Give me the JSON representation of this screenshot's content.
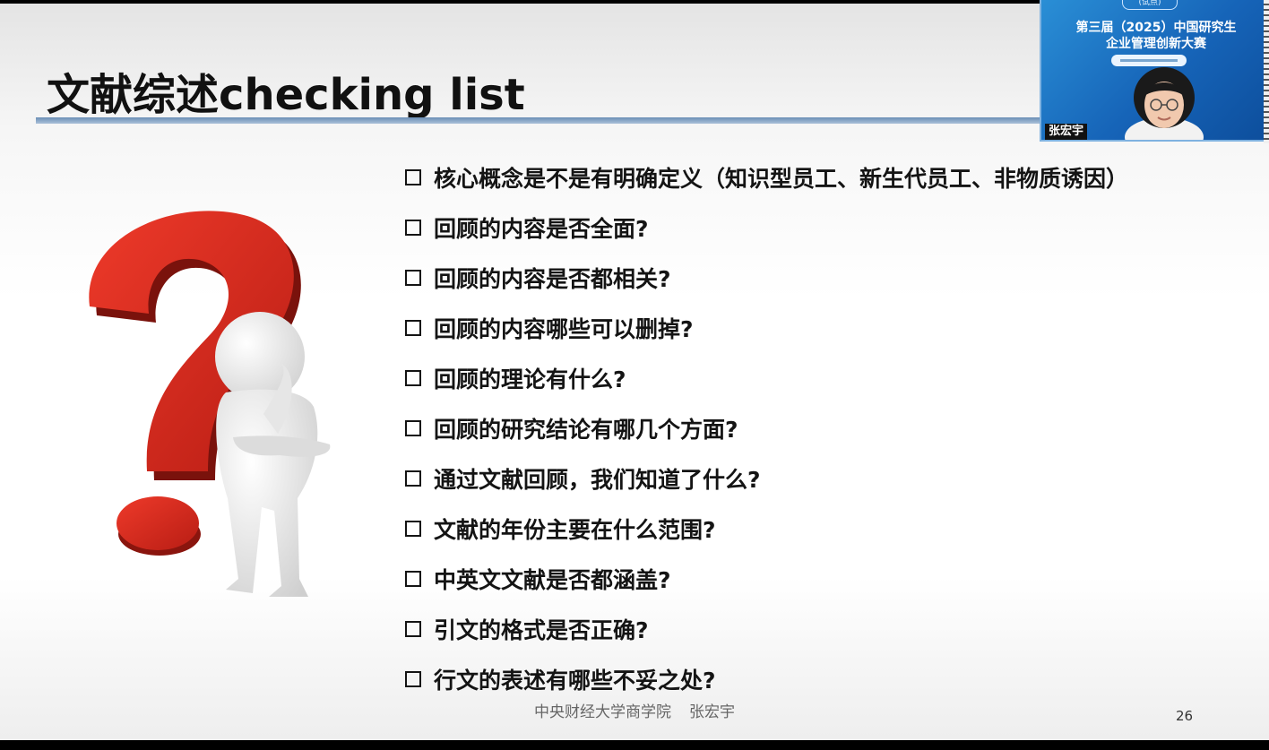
{
  "slide": {
    "title": "文献综述checking list",
    "items": [
      "核心概念是不是有明确定义（知识型员工、新生代员工、非物质诱因）",
      "回顾的内容是否全面?",
      "回顾的内容是否都相关?",
      "回顾的内容哪些可以删掉?",
      "回顾的理论有什么?",
      "回顾的研究结论有哪几个方面?",
      "通过文献回顾，我们知道了什么?",
      "文献的年份主要在什么范围?",
      "中英文文献是否都涵盖?",
      "引文的格式是否正确?",
      "行文的表述有哪些不妥之处?"
    ],
    "footer": {
      "school": "中央财经大学商学院",
      "author": "张宏宇"
    },
    "page_number": "26"
  },
  "video": {
    "tag": "(试点)",
    "line1": "第三届（2025）中国研究生",
    "line2": "企业管理创新大赛",
    "speaker_name": "张宏宇"
  },
  "colors": {
    "question_mark": "#d8291d",
    "title_rule": "#6b8fb6",
    "video_bg": "#1664b8"
  }
}
